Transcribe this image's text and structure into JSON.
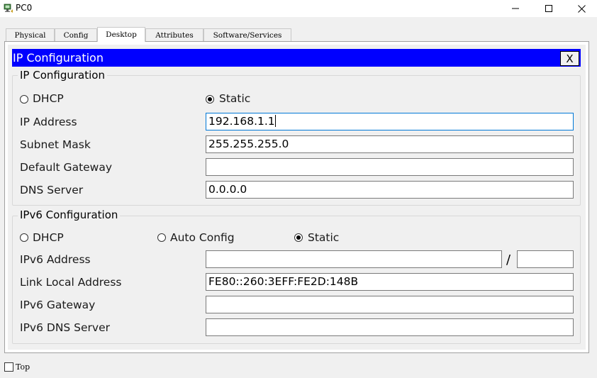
{
  "window": {
    "title": "PC0"
  },
  "tabs": [
    {
      "label": "Physical"
    },
    {
      "label": "Config"
    },
    {
      "label": "Desktop",
      "active": true
    },
    {
      "label": "Attributes"
    },
    {
      "label": "Software/Services"
    }
  ],
  "dialog": {
    "title": "IP Configuration",
    "close_label": "X"
  },
  "ipv4": {
    "group_label": "IP Configuration",
    "dhcp_label": "DHCP",
    "static_label": "Static",
    "mode": "Static",
    "ip_address_label": "IP Address",
    "ip_address_value": "192.168.1.1",
    "subnet_mask_label": "Subnet Mask",
    "subnet_mask_value": "255.255.255.0",
    "default_gateway_label": "Default Gateway",
    "default_gateway_value": "",
    "dns_server_label": "DNS Server",
    "dns_server_value": "0.0.0.0"
  },
  "ipv6": {
    "group_label": "IPv6 Configuration",
    "dhcp_label": "DHCP",
    "auto_config_label": "Auto Config",
    "static_label": "Static",
    "mode": "Static",
    "address_label": "IPv6 Address",
    "address_value": "",
    "prefix_separator": "/",
    "prefix_value": "",
    "link_local_label": "Link Local Address",
    "link_local_value": "FE80::260:3EFF:FE2D:148B",
    "gateway_label": "IPv6 Gateway",
    "gateway_value": "",
    "dns_server_label": "IPv6 DNS Server",
    "dns_server_value": ""
  },
  "footer": {
    "top_label": "Top",
    "top_checked": false
  },
  "colors": {
    "header_bg": "#0000ff",
    "header_text": "#ffffff",
    "focus_border": "#0078d7"
  }
}
